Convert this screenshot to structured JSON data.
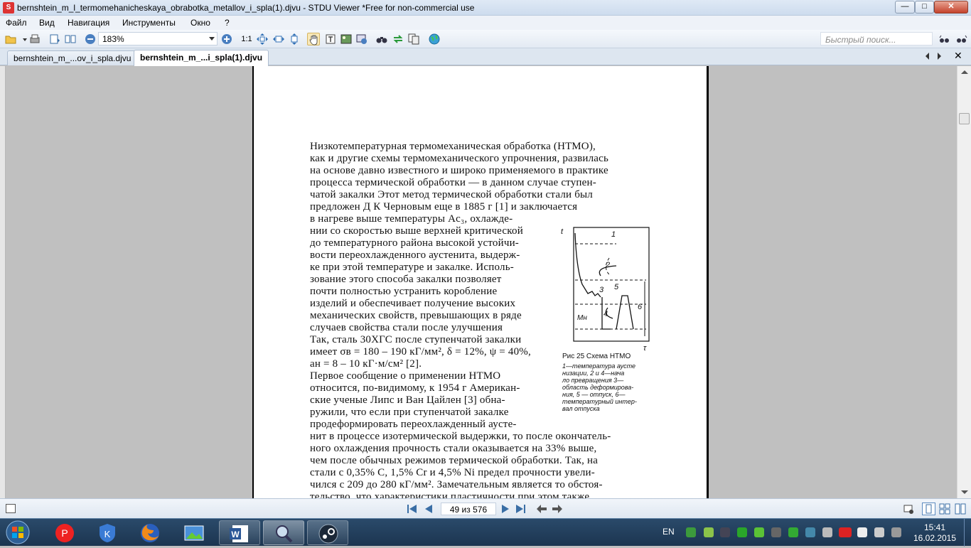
{
  "window": {
    "title": "bernshtein_m_l_termomehanicheskaya_obrabotka_metallov_i_spla(1).djvu - STDU Viewer *Free for non-commercial use",
    "controls": {
      "minimize": "—",
      "maximize": "□",
      "close": "✕"
    }
  },
  "menu": {
    "items": [
      "Файл",
      "Вид",
      "Навигация",
      "Инструменты",
      "Окно",
      "?"
    ]
  },
  "toolbar": {
    "zoom": "183%",
    "actual_size": "1:1",
    "search_placeholder": "Быстрый поиск..."
  },
  "tabs": [
    {
      "label": "bernshtein_m_...ov_i_spla.djvu",
      "active": false
    },
    {
      "label": "bernshtein_m_...i_spla(1).djvu",
      "active": true
    }
  ],
  "document": {
    "lines": [
      "Низкотемпературная  термомеханическая  обработка  (НТМО),",
      "как и другие схемы термомеханического упрочнения, развилась",
      "на основе давно известного и широко применяемого в практике",
      "процесса  термической  обработки — в  данном  случае  ступен-",
      "чатой закалки  Этот  метод  термической  обработки  стали  был",
      "предложен  Д   К   Черновым  еще  в  1885  г   [1]  и  заключается",
      "в  нагреве  выше  температуры  Ac₃,  охлажде-",
      "нии со скоростью выше верхней критической",
      "до  температурного  района  высокой  устойчи-",
      "вости переохлажденного аустенита, выдерж-",
      "ке  при  этой  температуре и закалке. Исполь-",
      "зование   этого   способа   закалки   позволяет",
      "почти     полностью     устранить     коробление",
      "изделий  и  обеспечивает  получение  высоких",
      "механических  свойств,  превышающих  в  ряде",
      "случаев   свойства   стали   после   улучшения",
      "Так, сталь 30ХГС после ступенчатой закалки",
      "имеет σв = 180 – 190 кГ/мм², δ = 12%, ψ = 40%,",
      "aн = 8 – 10  кГ·м/см²  [2].",
      "     Первое  сообщение  о  применении  НТМО",
      "относится,  по-видимому,  к  1954 г  Американ-",
      "ские  ученые  Липс  и  Ван  Цайлен  [3]  обна-",
      "ружили,  что  если  при  ступенчатой  закалке",
      "продеформировать   переохлажденный   аусте-",
      "нит  в процессе  изотермической  выдержки, то  после  окончатель-",
      "ного  охлаждения  прочность  стали  оказывается  на  33%  выше,",
      "чем  после  обычных  режимов  термической  обработки.  Так,  на",
      "стали  с  0,35% С,  1,5% Cr  и  4,5%  Ni  предел  прочности  увели-",
      "чился с 209 до 280 кГ/мм². Замечательным является то обстоя-",
      "тельство,   что   характеристики   пластичности   при   этом   также"
    ],
    "figure": {
      "axis_t": "t",
      "axis_tau": "τ",
      "labels": [
        "1",
        "2",
        "3",
        "4",
        "5",
        "6",
        "Mн"
      ],
      "caption_title": "Рис 25 Схема НТМО",
      "caption_lines": [
        "1—температура аусте",
        "низации, 2 и 4—нача",
        "ло превращения  3—",
        "область деформирова-",
        "ния, 5 — отпуск, 6—",
        "температурный интер-",
        "вал отпуска"
      ]
    }
  },
  "statusbar": {
    "page_display": "49 из 576"
  },
  "taskbar": {
    "language": "EN",
    "time": "15:41",
    "date": "16.02.2015"
  },
  "colors": {
    "title_gradient": "#cddcee",
    "taskbar": "#1c3550",
    "accent": "#3a7bd5"
  }
}
